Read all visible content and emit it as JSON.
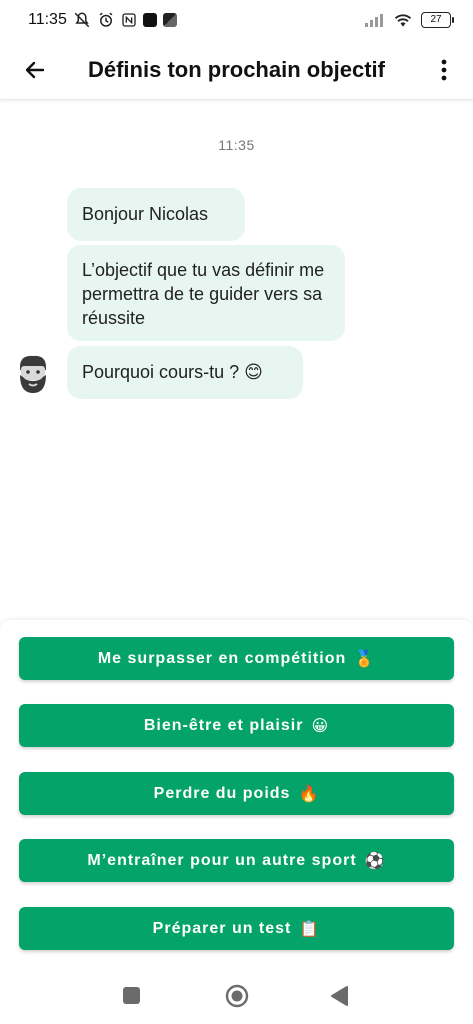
{
  "status_bar": {
    "time": "11:35",
    "battery": "27"
  },
  "app_bar": {
    "title": "Définis ton prochain objectif"
  },
  "chat": {
    "timestamp": "11:35",
    "messages": [
      "Bonjour Nicolas",
      "L’objectif que tu vas définir me permettra de te guider vers sa réussite",
      "Pourquoi cours-tu ? 😊"
    ]
  },
  "choices": [
    {
      "label": "Me surpasser en compétition",
      "emoji": "🏅"
    },
    {
      "label": "Bien-être et plaisir",
      "emoji": "😀"
    },
    {
      "label": "Perdre du poids",
      "emoji": "🔥"
    },
    {
      "label": "M’entraîner pour un autre sport",
      "emoji": "⚽"
    },
    {
      "label": "Préparer un test",
      "emoji": "📋"
    }
  ],
  "colors": {
    "accent": "#03a36a",
    "bubble": "#e8f6f1"
  },
  "icons": [
    "back-arrow-icon",
    "more-vert-icon",
    "coach-avatar-icon",
    "wifi-icon",
    "signal-icon",
    "alarm-icon",
    "mute-icon",
    "nfc-icon"
  ]
}
